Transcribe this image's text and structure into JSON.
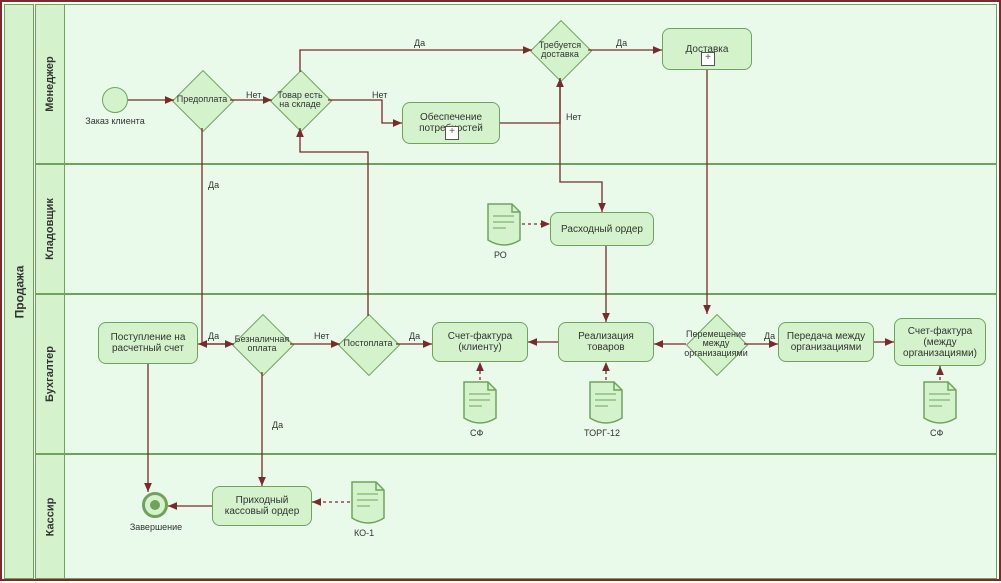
{
  "pool": {
    "title": "Продажа"
  },
  "lanes": [
    {
      "id": "manager",
      "title": "Менеджер"
    },
    {
      "id": "storekeeper",
      "title": "Кладовщик"
    },
    {
      "id": "accountant",
      "title": "Бухгалтер"
    },
    {
      "id": "cashier",
      "title": "Кассир"
    }
  ],
  "events": {
    "start_label": "Заказ клиента",
    "end_label": "Завершение"
  },
  "gateways": {
    "prepay": "Предоплата",
    "in_stock": "Товар есть на складе",
    "need_delivery": "Требуется доставка",
    "cashless": "Безналичная оплата",
    "postpay": "Постоплата",
    "interorg_move": "Перемещение между организациями"
  },
  "tasks": {
    "secure_needs": "Обеспечение потребностей",
    "delivery": "Доставка",
    "expense_order": "Расходный ордер",
    "bank_receipt": "Поступление на расчетный счет",
    "invoice_client": "Счет-фактура (клиенту)",
    "goods_sale": "Реализация товаров",
    "transfer_orgs": "Передача между организациями",
    "invoice_orgs": "Счет-фактура (между организациями)",
    "cash_receipt": "Приходный кассовый ордер"
  },
  "docs": {
    "ro": "РО",
    "sf": "СФ",
    "torg": "ТОРГ-12",
    "sf2": "СФ",
    "ko1": "КО-1"
  },
  "edge_labels": {
    "yes": "Да",
    "no": "Нет"
  }
}
